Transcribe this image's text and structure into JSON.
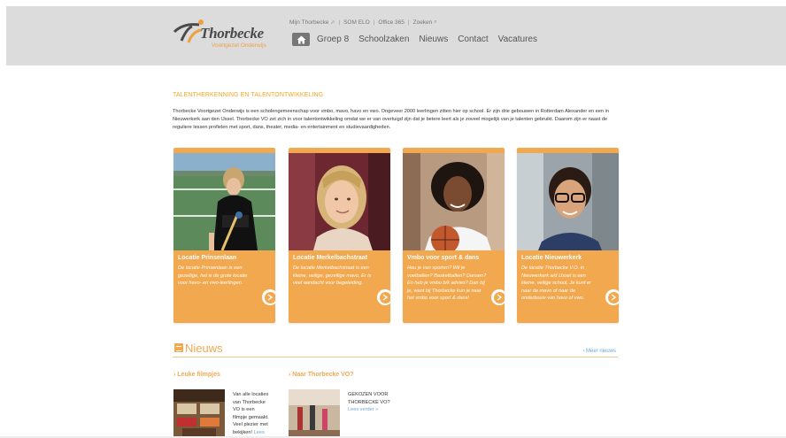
{
  "logo": {
    "name": "Thorbecke",
    "subtitle": "Voortgezet Onderwijs"
  },
  "topnav": {
    "links": [
      "Mijn Thorbecke",
      "SOM ELO",
      "Office 365",
      "Zoeken"
    ],
    "separator": "|"
  },
  "mainnav": {
    "items": [
      "Groep 8",
      "Schoolzaken",
      "Nieuws",
      "Contact",
      "Vacatures"
    ]
  },
  "intro": {
    "heading": "TALENTHERKENNING EN TALENTONTWIKKELING",
    "text": "Thorbecke Voortgezet Onderwijs is een scholengemeenschap voor vmbo, mavo, havo en vwo. Ongeveer 2000 leerlingen zitten hier op school. Er zijn drie gebouwen in Rotterdam Alexander en een in Nieuwerkerk aan den IJssel. Thorbecke VO zet zich in voor talentontwikkeling omdat we er van overtuigd zijn dat je betere leert als je zoveel mogelijk van je talenten gebruikt. Daarom zijn er naast de reguliere lessen profielen met sport, dans, theater, media- en entertainment en studievaardigheden."
  },
  "cards": [
    {
      "title": "Locatie Prinsenlaan",
      "desc": "De locatie Prinsenlaan is een gezellige, het is de grote locatie voor havo- en vwo-leerlingen."
    },
    {
      "title": "Locatie Merkelbachstraat",
      "desc": "De locatie Merkelbachstraat is een kleine, veilige, gezellige mavo. Er is veel aandacht voor begeleiding."
    },
    {
      "title": "Vmbo voor sport & dans",
      "desc": "Hou je van sporten? Wil je voetballen? Basketballen? Dansen? En heb je vmbo b/k advies? Dan bij je, want bij Thorbecke kun je naar het vmbo voor sport & dans!"
    },
    {
      "title": "Locatie Nieuwerkerk",
      "desc": "De locatie Thorbecke V.O. in Nieuwerkerk a/d IJssel is een kleine, veilige school. Je kunt er naar de mavo of naar de onderbouw van havo of vwo."
    }
  ],
  "news": {
    "title": "Nieuws",
    "more": "› Meer nieuws",
    "items": [
      {
        "title": "› Leuke filmpjes",
        "text_lines": [
          "Van alle locaties",
          "van Thorbecke",
          "VO is een",
          "filmpje gemaakt.",
          "Veel plezier met",
          "bekijken!"
        ],
        "link": "Lees"
      },
      {
        "title": "› Naar Thorbecke VO?",
        "text_lines": [
          "GEKOZEN VOOR",
          "THORBECKE VO?"
        ],
        "link": "Lees verder »"
      }
    ]
  },
  "colors": {
    "accent": "#f2a84e",
    "header_bg": "#dcdcdc",
    "link": "#6ba6d6"
  }
}
